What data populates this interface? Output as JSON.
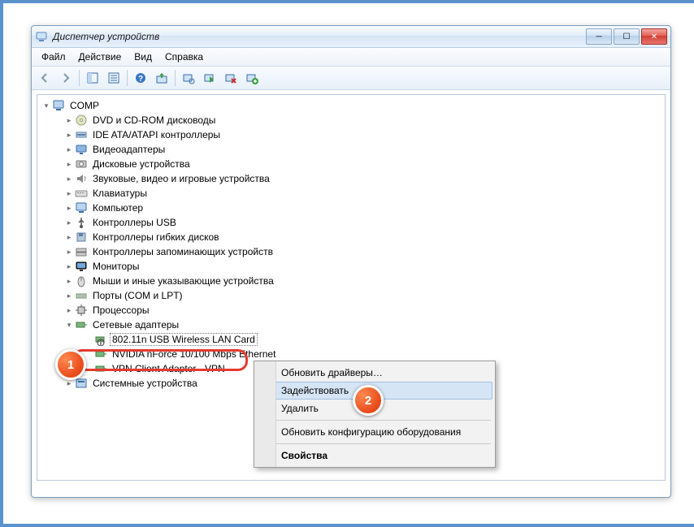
{
  "window": {
    "title": "Диспетчер устройств"
  },
  "menu": {
    "file": "Файл",
    "action": "Действие",
    "view": "Вид",
    "help": "Справка"
  },
  "toolbar_icons": {
    "back": "back-icon",
    "forward": "forward-icon",
    "show_tree": "tree-icon",
    "refresh": "refresh-icon",
    "help": "help-icon",
    "update_driver": "update-driver-icon",
    "scan": "scan-hardware-icon",
    "enable": "enable-device-icon",
    "uninstall": "uninstall-device-icon",
    "add_legacy": "add-legacy-icon"
  },
  "tree": {
    "root": "COMP",
    "categories": [
      {
        "label": "DVD и CD-ROM дисководы",
        "icon": "disc"
      },
      {
        "label": "IDE ATA/ATAPI контроллеры",
        "icon": "ide"
      },
      {
        "label": "Видеоадаптеры",
        "icon": "display"
      },
      {
        "label": "Дисковые устройства",
        "icon": "disk"
      },
      {
        "label": "Звуковые, видео и игровые устройства",
        "icon": "sound"
      },
      {
        "label": "Клавиатуры",
        "icon": "keyboard"
      },
      {
        "label": "Компьютер",
        "icon": "computer"
      },
      {
        "label": "Контроллеры USB",
        "icon": "usb"
      },
      {
        "label": "Контроллеры гибких дисков",
        "icon": "floppy"
      },
      {
        "label": "Контроллеры запоминающих устройств",
        "icon": "storage"
      },
      {
        "label": "Мониторы",
        "icon": "monitor"
      },
      {
        "label": "Мыши и иные указывающие устройства",
        "icon": "mouse"
      },
      {
        "label": "Порты (COM и LPT)",
        "icon": "port"
      },
      {
        "label": "Процессоры",
        "icon": "cpu"
      }
    ],
    "network": {
      "label": "Сетевые адаптеры",
      "devices": [
        {
          "label": "802.11n USB Wireless LAN Card",
          "disabled": true
        },
        {
          "label": "NVIDIA nForce 10/100 Mbps Ethernet",
          "disabled": false
        },
        {
          "label": "VPN Client Adapter - VPN",
          "disabled": false
        }
      ]
    },
    "last": {
      "label": "Системные устройства",
      "icon": "system"
    }
  },
  "context_menu": {
    "update": "Обновить драйверы…",
    "enable": "Задействовать",
    "delete": "Удалить",
    "scan": "Обновить конфигурацию оборудования",
    "props": "Свойства"
  },
  "callouts": {
    "c1": "1",
    "c2": "2"
  }
}
